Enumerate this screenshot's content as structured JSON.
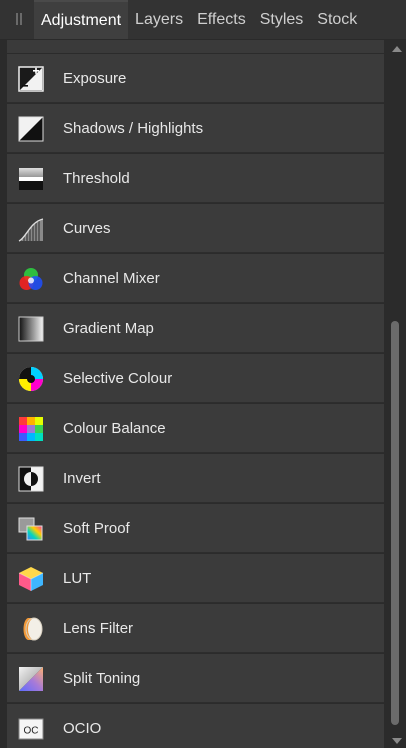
{
  "tabs": [
    {
      "label": "Adjustment",
      "active": true
    },
    {
      "label": "Layers"
    },
    {
      "label": "Effects"
    },
    {
      "label": "Styles"
    },
    {
      "label": "Stock"
    }
  ],
  "items": [
    {
      "label": "Exposure",
      "icon": "exposure-icon"
    },
    {
      "label": "Shadows / Highlights",
      "icon": "shadows-highlights-icon"
    },
    {
      "label": "Threshold",
      "icon": "threshold-icon"
    },
    {
      "label": "Curves",
      "icon": "curves-icon"
    },
    {
      "label": "Channel Mixer",
      "icon": "channel-mixer-icon"
    },
    {
      "label": "Gradient Map",
      "icon": "gradient-map-icon"
    },
    {
      "label": "Selective Colour",
      "icon": "selective-colour-icon"
    },
    {
      "label": "Colour Balance",
      "icon": "colour-balance-icon"
    },
    {
      "label": "Invert",
      "icon": "invert-icon"
    },
    {
      "label": "Soft Proof",
      "icon": "soft-proof-icon"
    },
    {
      "label": "LUT",
      "icon": "lut-icon"
    },
    {
      "label": "Lens Filter",
      "icon": "lens-filter-icon"
    },
    {
      "label": "Split Toning",
      "icon": "split-toning-icon"
    },
    {
      "label": "OCIO",
      "icon": "ocio-icon"
    }
  ],
  "ocio_icon_text": "OC",
  "scroll_position": 0.6
}
